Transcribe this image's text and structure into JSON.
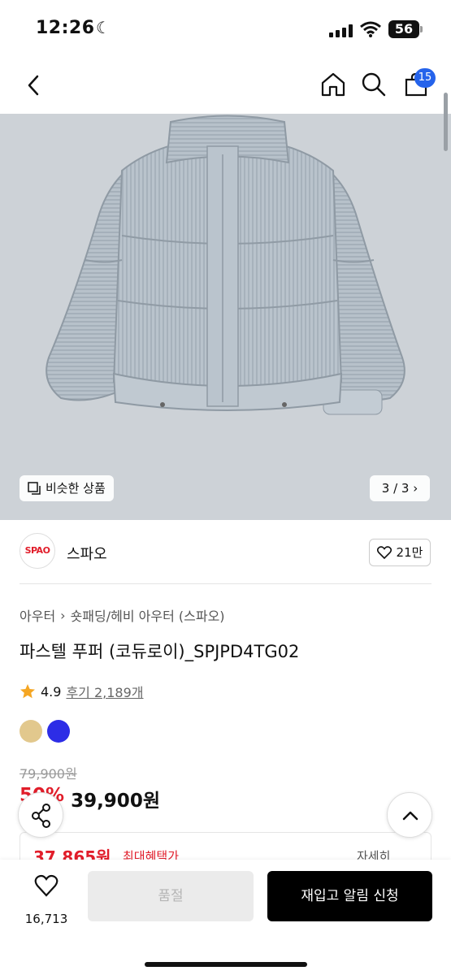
{
  "status_bar": {
    "time": "12:26",
    "battery": "56"
  },
  "header": {
    "cart_count": "15"
  },
  "hero": {
    "similar_label": "비슷한 상품",
    "pager": "3 / 3"
  },
  "brand": {
    "logo_text": "SPAO",
    "name": "스파오",
    "likes": "21만",
    "logo_color": "#e11d2a"
  },
  "breadcrumb": [
    "아우터",
    "숏패딩/헤비 아우터 (스파오)"
  ],
  "product": {
    "title": "파스텔 푸퍼 (코듀로이)_SPJPD4TG02",
    "rating": "4.9",
    "reviews": "후기 2,189개",
    "colors": [
      "#e2c88d",
      "#2d2de6"
    ],
    "original_price": "79,900원",
    "discount": "50%",
    "sale_price": "39,900원"
  },
  "benefit": {
    "price": "37,865원",
    "label": "최대혜택가",
    "detail": "자세히"
  },
  "bottom_bar": {
    "wish_count": "16,713",
    "soldout_label": "품절",
    "restock_label": "재입고 알림 신청"
  },
  "icons": [
    "back-icon",
    "home-icon",
    "search-icon",
    "bag-icon",
    "similar-icon",
    "chevron-right-icon",
    "heart-icon",
    "star-icon",
    "share-icon",
    "chevron-up-icon",
    "info-icon",
    "chevron-down-icon"
  ]
}
